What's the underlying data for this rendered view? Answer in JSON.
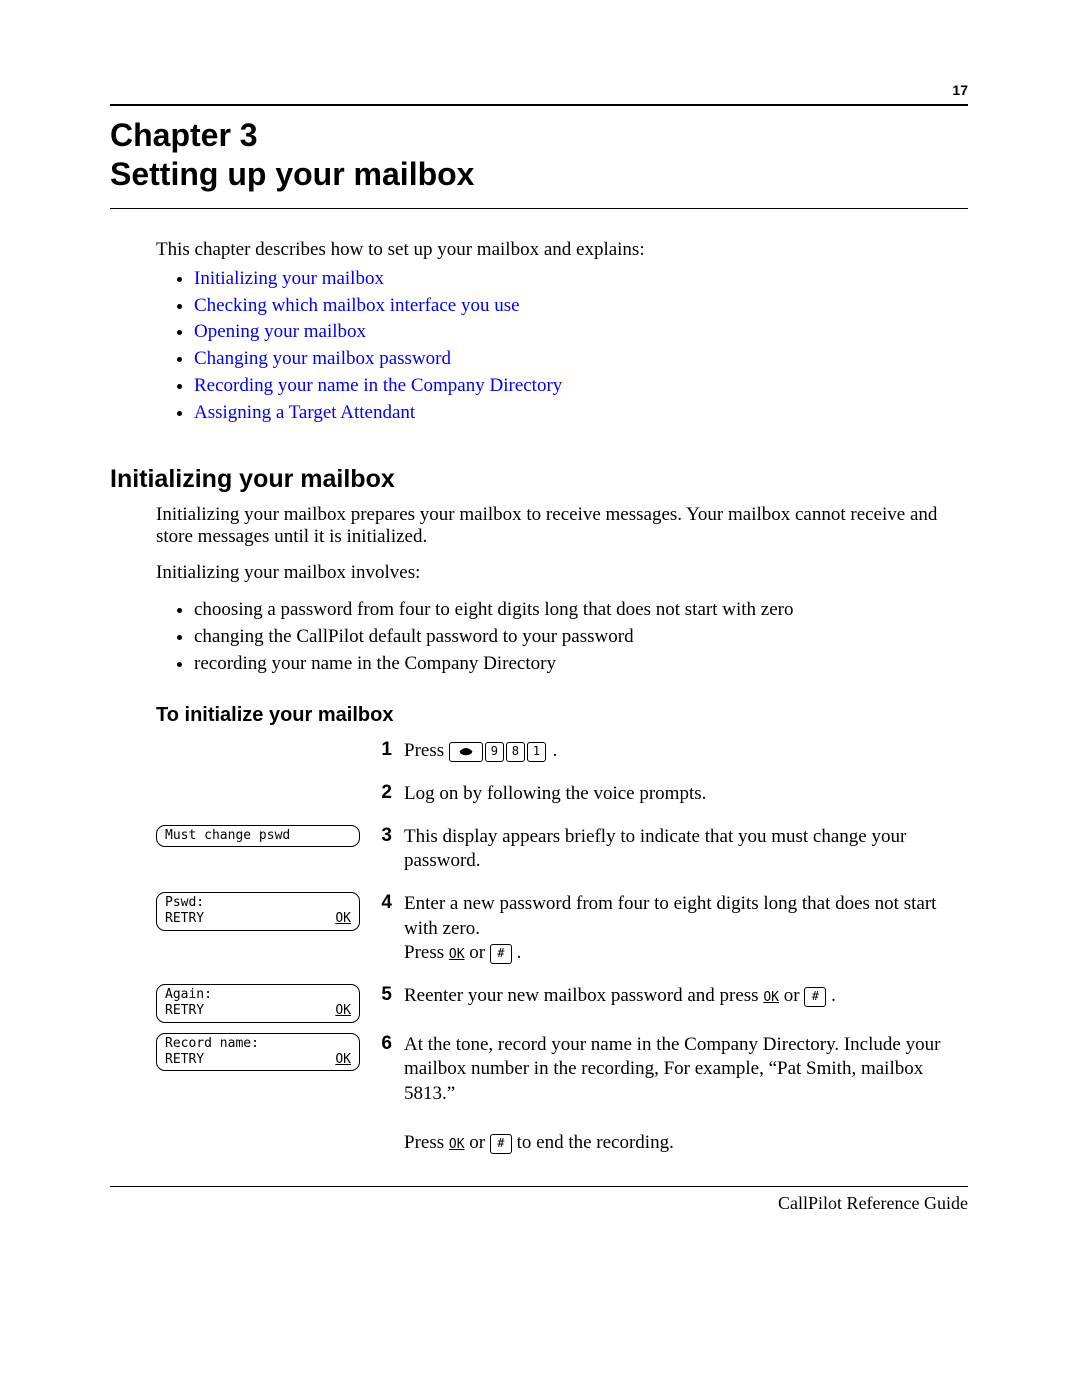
{
  "page_number": "17",
  "chapter": {
    "line1": "Chapter 3",
    "line2": "Setting up your mailbox"
  },
  "intro": "This chapter describes how to set up your mailbox and explains:",
  "links": [
    "Initializing your mailbox",
    "Checking which mailbox interface you use",
    "Opening your mailbox",
    "Changing your mailbox password",
    "Recording your name in the Company Directory",
    "Assigning a Target Attendant"
  ],
  "section1_title": "Initializing your mailbox",
  "section1_para1": "Initializing your mailbox prepares your mailbox to receive messages. Your mailbox cannot receive and store messages until it is initialized.",
  "section1_para2": "Initializing your mailbox involves:",
  "section1_bullets": [
    "choosing a password from four to eight digits long that does not start with zero",
    "changing the CallPilot default password to your password",
    "recording your name in the Company Directory"
  ],
  "subsection_title": "To initialize your mailbox",
  "steps": {
    "s1": {
      "num": "1",
      "pre": "Press ",
      "d1": "9",
      "d2": "8",
      "d3": "1",
      "post": " ."
    },
    "s2": {
      "num": "2",
      "text": "Log on by following the voice prompts."
    },
    "s3": {
      "num": "3",
      "text": "This display appears briefly to indicate that you must change your password.",
      "display_line1": "Must change pswd"
    },
    "s4": {
      "num": "4",
      "line1": "Enter a new password from four to eight digits long that does not start with zero.",
      "press_pre": "Press ",
      "ok": "OK",
      "or": " or ",
      "hash": "#",
      "period": " .",
      "display_line1": "Pswd:",
      "display_left": "RETRY",
      "display_right": "OK"
    },
    "s5": {
      "num": "5",
      "pre": "Reenter your new mailbox password and press ",
      "ok": "OK",
      "or": " or ",
      "hash": "#",
      "period": " .",
      "display_line1": "Again:",
      "display_left": "RETRY",
      "display_right": "OK"
    },
    "s6": {
      "num": "6",
      "para": "At the tone, record your name in the Company Directory. Include your mailbox number in the recording, For example, “Pat Smith, mailbox 5813.”",
      "press_pre": "Press ",
      "ok": "OK",
      "or": " or ",
      "hash": "#",
      "post": " to end the recording.",
      "display_line1": "Record name:",
      "display_left": "RETRY",
      "display_right": "OK"
    }
  },
  "footer": "CallPilot Reference Guide"
}
